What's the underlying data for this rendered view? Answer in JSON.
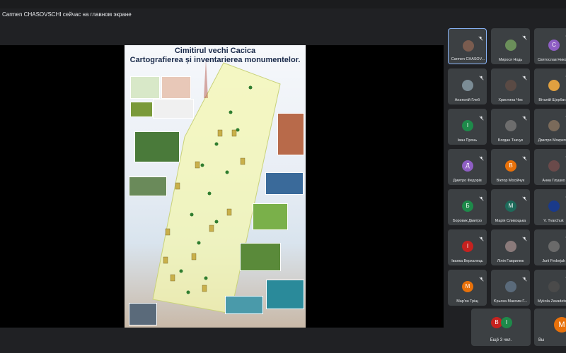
{
  "banner": {
    "presenter_text": "Carmen CHASOVSCHI сейчас на главном экране"
  },
  "slide": {
    "title_line1": "Cimitirul vechi Cacica",
    "title_line2": "Cartografierea și inventarierea monumentelor."
  },
  "participants": [
    {
      "name": "Carmen CHASOV...",
      "avatar": "",
      "color": "#7a5c4f",
      "active": true
    },
    {
      "name": "Мирося Нодь",
      "avatar": "",
      "color": "#6b8f5a"
    },
    {
      "name": "Святослав Нико...",
      "avatar": "С",
      "color": "#8e5ec4"
    },
    {
      "name": "Анатолій Глеб",
      "avatar": "",
      "color": "#7b8c95"
    },
    {
      "name": "Христина Чек",
      "avatar": "",
      "color": "#5a4a44"
    },
    {
      "name": "Віталій Щербат...",
      "avatar": "",
      "color": "#e0a040"
    },
    {
      "name": "Іван Пронь",
      "avatar": "І",
      "color": "#1e8a4a"
    },
    {
      "name": "Богдан Ткачук",
      "avatar": "",
      "color": "#6d6d6d"
    },
    {
      "name": "Дмитро Мокреп...",
      "avatar": "",
      "color": "#7a6a5a"
    },
    {
      "name": "Дмитро Федорів",
      "avatar": "Д",
      "color": "#8e5ec4"
    },
    {
      "name": "Віктор Мосійчук",
      "avatar": "В",
      "color": "#e8710a"
    },
    {
      "name": "Анна Глушко",
      "avatar": "",
      "color": "#6a4a4a"
    },
    {
      "name": "Боровик Дмитро",
      "avatar": "Б",
      "color": "#1e8a4a"
    },
    {
      "name": "Марія Сливоцька",
      "avatar": "М",
      "color": "#1e6a5a"
    },
    {
      "name": "V. Tvarchuk",
      "avatar": "",
      "color": "#1a3a8a"
    },
    {
      "name": "Іванка Верхалець",
      "avatar": "І",
      "color": "#c5221f"
    },
    {
      "name": "Лілія Гаврилюк",
      "avatar": "",
      "color": "#8a7a7a"
    },
    {
      "name": "Jurii Fedorjak",
      "avatar": "",
      "color": "#6a6a6a"
    },
    {
      "name": "Мар'ян Тріщ",
      "avatar": "М",
      "color": "#e8710a"
    },
    {
      "name": "Єрьоха Максим Г...",
      "avatar": "",
      "color": "#5a6a7a"
    },
    {
      "name": "Mykola Zavadets...",
      "avatar": "",
      "color": "#4a4a4a"
    }
  ],
  "more": {
    "label": "Ещё 3 чел.",
    "avatars": [
      "В",
      "І"
    ]
  },
  "self": {
    "label": "Вы",
    "avatar": "М"
  }
}
